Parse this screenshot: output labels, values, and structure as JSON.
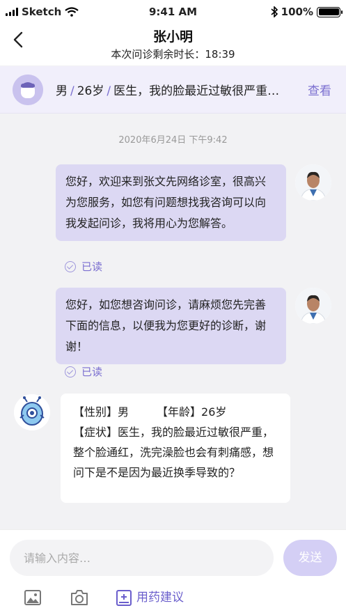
{
  "status_bar": {
    "carrier": "Sketch",
    "time": "9:41 AM",
    "battery": "100%"
  },
  "nav": {
    "title": "张小明",
    "subtitle": "本次问诊剩余时长：18:39"
  },
  "patient": {
    "gender": "男",
    "age": "26岁",
    "summary": "医生，我的脸最近过敏很严重…",
    "view_label": "查看"
  },
  "chat": {
    "timestamp": "2020年6月24日   下午9:42",
    "messages": [
      {
        "text": "您好，欢迎来到张文先网络诊室，很高兴为您服务，如您有问题想找我咨询可以向我发起问诊，我将用心为您解答。",
        "status": "已读"
      },
      {
        "text": "您好，如您想咨询问诊，请麻烦您先完善下面的信息，以便我为您更好的诊断，谢谢！",
        "status": "已读"
      }
    ],
    "patient_card": {
      "gender_label": "【性别】",
      "gender": "男",
      "age_label": "【年龄】",
      "age": "26岁",
      "symptom_label": "【症状】",
      "symptom": "医生，我的脸最近过敏很严重，整个脸通红，洗完澡脸也会有刺痛感，想问下是不是因为最近换季导致的？"
    }
  },
  "footer": {
    "placeholder": "请输入内容…",
    "send_label": "发送",
    "med_label": "用药建议"
  },
  "colors": {
    "accent": "#7b6fd0",
    "doctor_bubble": "#dcd8f3",
    "send_disabled": "#d4cff5"
  }
}
